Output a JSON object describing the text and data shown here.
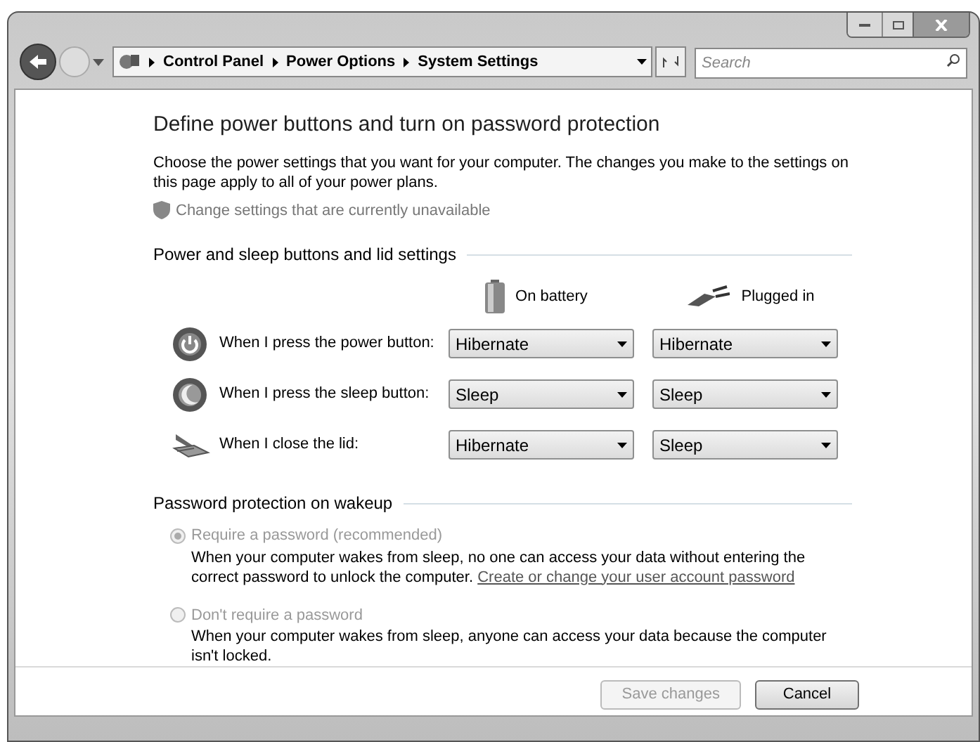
{
  "address_bar": {
    "breadcrumbs": [
      "Control Panel",
      "Power Options",
      "System Settings"
    ]
  },
  "search": {
    "placeholder": "Search"
  },
  "heading": "Define power buttons and turn on password protection",
  "intro": "Choose the power settings that you want for your computer. The changes you make to the settings on this page apply to all of your power plans.",
  "elevate_link": {
    "label": "Change settings that are currently unavailable",
    "disabled": true
  },
  "power_section": {
    "title": "Power and sleep buttons and lid settings",
    "columns": [
      "On battery",
      "Plugged in"
    ],
    "rows": [
      {
        "kind": "power",
        "label": "When I press the power button:",
        "values": [
          "Hibernate",
          "Hibernate"
        ]
      },
      {
        "kind": "sleep",
        "label": "When I press the sleep button:",
        "values": [
          "Sleep",
          "Sleep"
        ]
      },
      {
        "kind": "lid",
        "label": "When I close the lid:",
        "values": [
          "Hibernate",
          "Sleep"
        ]
      }
    ]
  },
  "password_section": {
    "title": "Password protection on wakeup",
    "options": [
      {
        "label": "Require a password (recommended)",
        "selected": true,
        "disabled": true,
        "description": "When your computer wakes from sleep, no one can access your data without entering the correct password to unlock the computer.",
        "link": "Create or change your user account password"
      },
      {
        "label": "Don't require a password",
        "selected": false,
        "disabled": true,
        "description": "When your computer wakes from sleep, anyone can access your data because the computer isn't locked."
      }
    ]
  },
  "buttons": [
    {
      "label": "Save changes",
      "disabled": true
    },
    {
      "label": "Cancel",
      "disabled": false
    }
  ]
}
